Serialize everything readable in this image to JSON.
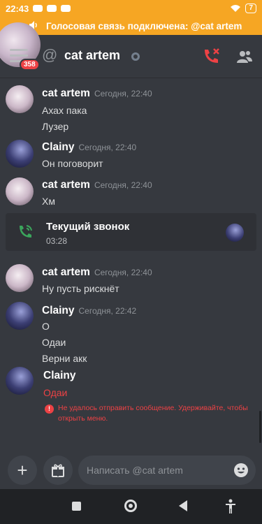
{
  "status_bar": {
    "time": "22:43",
    "battery": "7"
  },
  "voice_banner": {
    "text": "Голосовая связь подключена: @cat artem"
  },
  "header": {
    "badge_count": "358",
    "at_symbol": "@",
    "title": "cat artem"
  },
  "messages": [
    {
      "author": "cat artem",
      "time": "Сегодня, 22:40",
      "lines": [
        "Ахах пака",
        "Лузер"
      ]
    },
    {
      "author": "Clainy",
      "time": "Сегодня, 22:40",
      "lines": [
        "Он поговорит"
      ]
    },
    {
      "author": "cat artem",
      "time": "Сегодня, 22:40",
      "lines": [
        "Хм"
      ]
    },
    {
      "author": "cat artem",
      "time": "Сегодня, 22:40",
      "lines": [
        "Ну пусть рискнёт"
      ]
    },
    {
      "author": "Clainy",
      "time": "Сегодня, 22:42",
      "lines": [
        "О",
        "Одаи",
        "Верни акк"
      ]
    }
  ],
  "call_card": {
    "title": "Текущий звонок",
    "duration": "03:28"
  },
  "failed_message": {
    "author": "Clainy",
    "text": "Одаи",
    "error_icon": "!",
    "error": "Не удалось отправить сообщение. Удерживайте, чтобы открыть меню."
  },
  "input": {
    "placeholder": "Написать @cat artem",
    "plus_label": "+"
  },
  "colors": {
    "banner": "#f6a623",
    "background": "#36393f",
    "error": "#ed4245",
    "call_green": "#3ba55c"
  }
}
